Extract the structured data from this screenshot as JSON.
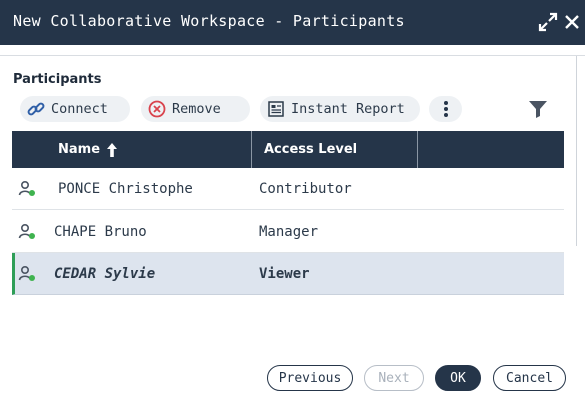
{
  "window": {
    "title": "New Collaborative Workspace - Participants",
    "expand_icon": "expand-arrows-icon",
    "close_icon": "close-icon"
  },
  "section": {
    "label": "Participants"
  },
  "toolbar": {
    "connect_label": "Connect",
    "remove_label": "Remove",
    "report_label": "Instant Report",
    "more_icon": "vertical-ellipsis-icon",
    "filter_icon": "funnel-icon"
  },
  "table": {
    "columns": [
      "Name",
      "Access Level",
      ""
    ],
    "sort": {
      "column": "Name",
      "direction": "ascending",
      "icon": "arrow-up-icon"
    },
    "rows": [
      {
        "name": "PONCE Christophe",
        "access": "Contributor",
        "selected": false,
        "status": "online"
      },
      {
        "name": "CHAPE Bruno",
        "access": "Manager",
        "selected": false,
        "status": "online"
      },
      {
        "name": "CEDAR Sylvie",
        "access": "Viewer",
        "selected": true,
        "status": "online"
      }
    ]
  },
  "footer": {
    "previous_label": "Previous",
    "next_label": "Next",
    "ok_label": "OK",
    "cancel_label": "Cancel",
    "next_disabled": true
  },
  "colors": {
    "header_bg": "#253549",
    "selected_row_bg": "#dde4ee",
    "selection_accent": "#2e9e57",
    "status_online": "#3fb34f",
    "remove_icon": "#d9434d"
  }
}
